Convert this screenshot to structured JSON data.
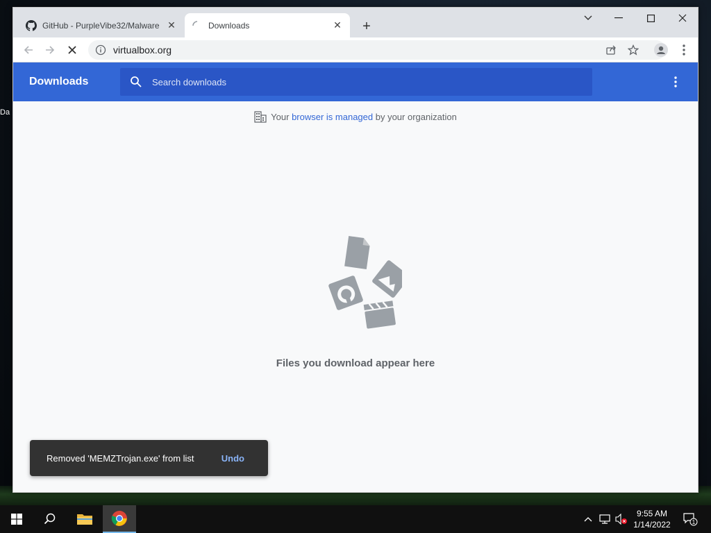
{
  "desktop": {
    "peek_label": "Da"
  },
  "tabs": [
    {
      "title": "GitHub - PurpleVibe32/Malware",
      "icon": "github-icon",
      "active": false
    },
    {
      "title": "Downloads",
      "icon": "loading-spinner-icon",
      "active": true
    }
  ],
  "toolbar": {
    "url": "virtualbox.org"
  },
  "downloads": {
    "title": "Downloads",
    "search_placeholder": "Search downloads",
    "managed_prefix": "Your ",
    "managed_link": "browser is managed",
    "managed_suffix": " by your organization",
    "empty_text": "Files you download appear here"
  },
  "toast": {
    "message": "Removed 'MEMZTrojan.exe' from list",
    "undo_label": "Undo"
  },
  "taskbar": {
    "time": "9:55 AM",
    "date": "1/14/2022",
    "notification_count": "1"
  },
  "colors": {
    "header_blue": "#3367d6",
    "toast_bg": "#323232",
    "undo_link": "#8ab4f8"
  }
}
